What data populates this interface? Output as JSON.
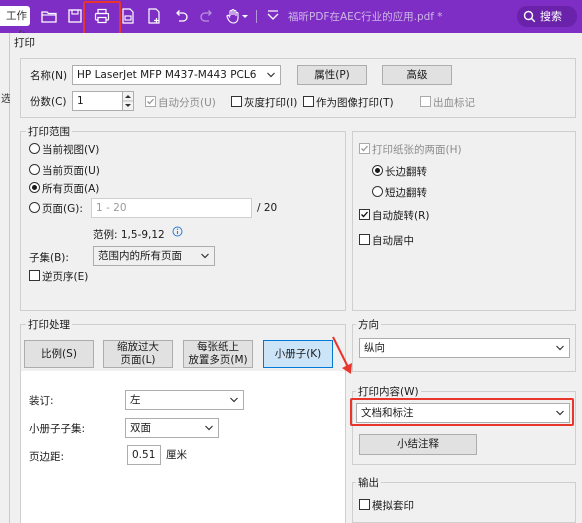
{
  "toolbar": {
    "workspace_tab": "工作台",
    "doc_title": "福昕PDF在AEC行业的应用.pdf *",
    "search_label": "搜索",
    "icons": [
      "folder-open-icon",
      "save-icon",
      "print-icon",
      "export-icon",
      "new-file-icon",
      "undo-icon",
      "redo-icon",
      "hand-tool-icon",
      "chevron-down-icon",
      "collapse-icon"
    ]
  },
  "left_strip": {
    "char": "选"
  },
  "dialog": {
    "title": "打印",
    "name_label": "名称(N)",
    "printer": "HP LaserJet MFP M437-M443 PCL6",
    "properties_btn": "属性(P)",
    "advanced_btn": "高级",
    "copies_label": "份数(C)",
    "copies_value": "1",
    "collate_label": "自动分页(U)",
    "grayscale_label": "灰度打印(I)",
    "print_as_image_label": "作为图像打印(T)",
    "bleed_marks_label": "出血标记"
  },
  "print_range": {
    "title": "打印范围",
    "current_view": "当前视图(V)",
    "current_page": "当前页面(U)",
    "all_pages": "所有页面(A)",
    "pages_label": "页面(G):",
    "pages_placeholder": "1 - 20",
    "pages_total": "/ 20",
    "example": "范例: 1,5-9,12",
    "subset_label": "子集(B):",
    "subset_value": "范围内的所有页面",
    "reverse_label": "逆页序(E)",
    "selected": "all_pages"
  },
  "duplex": {
    "both_sides_label": "打印纸张的两面(H)",
    "long_edge": "长边翻转",
    "short_edge": "短边翻转",
    "auto_rotate": "自动旋转(R)",
    "auto_center": "自动居中"
  },
  "handling": {
    "title": "打印处理",
    "scale_btn": "比例(S)",
    "shrink_btn_l1": "缩放过大",
    "shrink_btn_l2": "页面(L)",
    "multi_btn_l1": "每张纸上",
    "multi_btn_l2": "放置多页(M)",
    "booklet_btn": "小册子(K)",
    "binding_label": "装订:",
    "binding_value": "左",
    "subset_label": "小册子子集:",
    "subset_value": "双面",
    "margin_label": "页边距:",
    "margin_value": "0.51",
    "margin_unit": "厘米"
  },
  "orientation": {
    "title": "方向",
    "value": "纵向"
  },
  "content": {
    "title": "打印内容(W)",
    "value": "文档和标注",
    "summarize_btn": "小结注释"
  },
  "output": {
    "title": "输出",
    "simulate_label": "模拟套印"
  },
  "colors": {
    "toolbar": "#7f2ec5",
    "highlight": "#e8352e",
    "selected_button": "#cce4f7",
    "selected_button_border": "#0078d7"
  }
}
